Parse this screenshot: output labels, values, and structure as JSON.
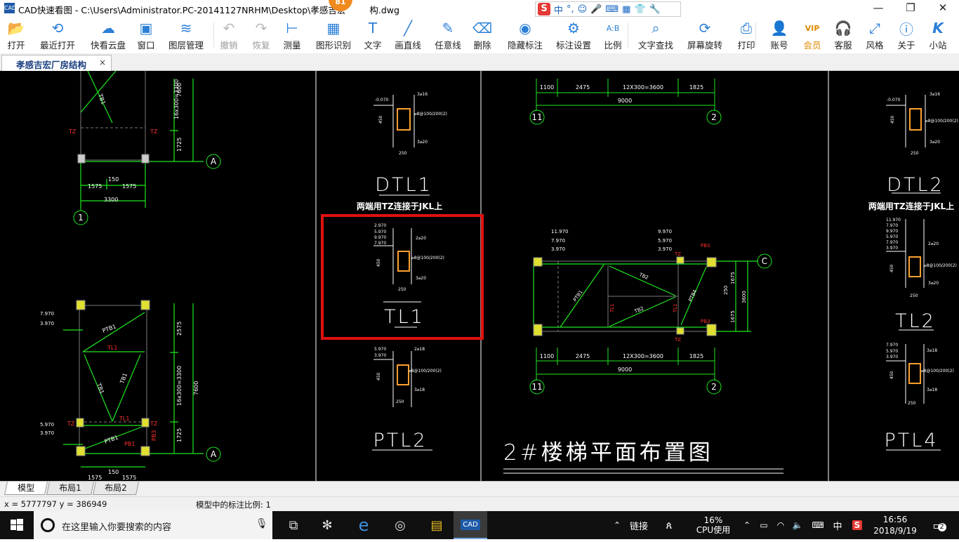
{
  "window": {
    "title_prefix": "CAD快速看图 - C:\\Users\\Administrator.PC-20141127NRHM\\Desktop\\孝感吉宏",
    "title_suffix": "构.dwg",
    "badge": "81",
    "app_icon": "CAD",
    "controls": {
      "minimize": "—",
      "restore": "❐",
      "close": "✕"
    }
  },
  "ime": {
    "mode": "中",
    "punct": "°,"
  },
  "toolbar": [
    {
      "name": "open",
      "label": "打开",
      "icon": "folder-icon",
      "glyph": "📂",
      "enabled": true
    },
    {
      "name": "recent",
      "label": "最近打开",
      "icon": "clock-icon",
      "glyph": "⟲",
      "enabled": true
    },
    {
      "name": "cloud",
      "label": "快看云盘",
      "icon": "cloud-icon",
      "glyph": "☁",
      "enabled": true
    },
    {
      "name": "window",
      "label": "窗口",
      "icon": "window-icon",
      "glyph": "▣",
      "enabled": true
    },
    {
      "name": "layers",
      "label": "图层管理",
      "icon": "layers-icon",
      "glyph": "≋",
      "enabled": true
    },
    {
      "name": "undo",
      "label": "撤销",
      "icon": "undo-icon",
      "glyph": "↶",
      "enabled": false
    },
    {
      "name": "redo",
      "label": "恢复",
      "icon": "redo-icon",
      "glyph": "↷",
      "enabled": false
    },
    {
      "name": "measure",
      "label": "测量",
      "icon": "ruler-icon",
      "glyph": "⊢",
      "enabled": true
    },
    {
      "name": "shape",
      "label": "图形识别",
      "icon": "shape-recognize-icon",
      "glyph": "▦",
      "enabled": true
    },
    {
      "name": "text",
      "label": "文字",
      "icon": "text-icon",
      "glyph": "T",
      "enabled": true
    },
    {
      "name": "line",
      "label": "画直线",
      "icon": "line-icon",
      "glyph": "╱",
      "enabled": true
    },
    {
      "name": "freeline",
      "label": "任意线",
      "icon": "pen-icon",
      "glyph": "✎",
      "enabled": true
    },
    {
      "name": "erase",
      "label": "删除",
      "icon": "eraser-icon",
      "glyph": "⌫",
      "enabled": true
    },
    {
      "name": "hide",
      "label": "隐藏标注",
      "icon": "eye-off-icon",
      "glyph": "◉",
      "enabled": true
    },
    {
      "name": "dimset",
      "label": "标注设置",
      "icon": "settings-icon",
      "glyph": "⚙",
      "enabled": true
    },
    {
      "name": "scale",
      "label": "比例",
      "icon": "scale-icon",
      "glyph": "A:B",
      "enabled": true
    },
    {
      "name": "textfind",
      "label": "文字查找",
      "icon": "search-text-icon",
      "glyph": "⌕",
      "enabled": true
    },
    {
      "name": "rotate",
      "label": "屏幕旋转",
      "icon": "rotate-icon",
      "glyph": "⟳",
      "enabled": true
    },
    {
      "name": "print",
      "label": "打印",
      "icon": "printer-icon",
      "glyph": "⎙",
      "enabled": true
    },
    {
      "name": "account",
      "label": "账号",
      "icon": "user-icon",
      "glyph": "👤",
      "enabled": true
    },
    {
      "name": "vip",
      "label": "会员",
      "icon": "vip-icon",
      "glyph": "VIP",
      "enabled": true
    },
    {
      "name": "service",
      "label": "客服",
      "icon": "headset-icon",
      "glyph": "🎧",
      "enabled": true
    },
    {
      "name": "style",
      "label": "风格",
      "icon": "style-icon",
      "glyph": "⤢",
      "enabled": true
    },
    {
      "name": "about",
      "label": "关于",
      "icon": "info-icon",
      "glyph": "ⓘ",
      "enabled": true
    },
    {
      "name": "site",
      "label": "小站",
      "icon": "k-logo-icon",
      "glyph": "K",
      "enabled": true
    }
  ],
  "doc_tab": {
    "label": "孝感吉宏厂房结构",
    "close": "×"
  },
  "drawing": {
    "labels": {
      "dtl1": "DTL1",
      "dtl1_note": "两端用TZ连接于JKL上",
      "tl1": "TL1",
      "ptl2": "PTL2",
      "dtl2": "DTL2",
      "dtl2_note": "两端用TZ连接于JKL上",
      "tl2": "TL2",
      "ptl4": "PTL4",
      "plan_title": "2#楼梯平面布置图"
    },
    "axes": {
      "a": "A",
      "c": "C",
      "one": "1",
      "eleven": "11",
      "two": "2"
    },
    "dims": {
      "d7600": "7600",
      "d1725": "1725",
      "d16x300": "16x300=3300",
      "d2575": "2575",
      "d1575": "1575",
      "d150": "150",
      "d3300": "3300",
      "d1100": "1100",
      "d2475": "2475",
      "d12x300": "12X300=3600",
      "d1825": "1825",
      "d9000": "9000",
      "d1675": "1675",
      "d3600": "3600",
      "d250": "250",
      "d450": "450"
    },
    "elev": {
      "e1": "11.970",
      "e2": "7.970",
      "e3": "5.970",
      "e4": "3.970",
      "e5": "9.970",
      "e6": "2.970"
    },
    "tags": {
      "tz": "TZ",
      "tb1": "TB1",
      "tb2": "TB2",
      "ptb1": "PTB1",
      "ptb4": "PTB4",
      "pb1": "PB1",
      "pb3": "PB3",
      "tl1s": "TL1"
    },
    "rebar": {
      "r1": "2⌀20",
      "r2": "3⌀20",
      "r3": "3⌀16",
      "r4": "3⌀18",
      "r5": "2⌀18",
      "r6": "⌀8@100/200(2)"
    }
  },
  "layout_tabs": [
    {
      "label": "模型",
      "active": true
    },
    {
      "label": "布局1",
      "active": false
    },
    {
      "label": "布局2",
      "active": false
    }
  ],
  "status": {
    "coords": "x = 5777797  y = 386949",
    "scale": "模型中的标注比例: 1"
  },
  "taskbar": {
    "search_placeholder": "在这里输入你要搜索的内容",
    "link": "链接",
    "cpu_percent": "16%",
    "cpu_label": "CPU使用",
    "lang": "中",
    "time": "16:56",
    "date": "2018/9/19",
    "notif_count": "2"
  }
}
